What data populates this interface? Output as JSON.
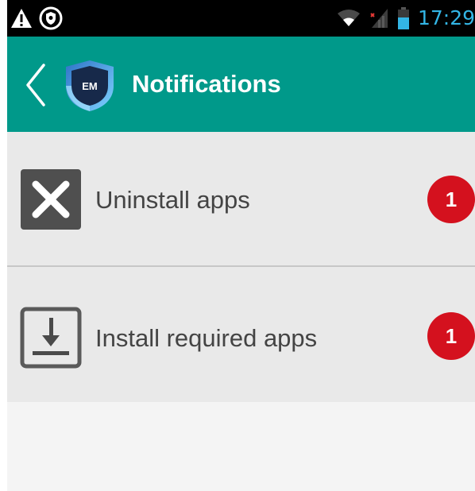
{
  "status_bar": {
    "time": "17:29",
    "left_icons": [
      "warning-icon",
      "shield-icon"
    ],
    "right_icons": [
      "wifi-icon",
      "signal-icon",
      "battery-icon"
    ]
  },
  "app_bar": {
    "title": "Notifications",
    "logo_text": "EM",
    "back_icon": "chevron-left-icon",
    "background": "#00998a"
  },
  "list": {
    "items": [
      {
        "label": "Uninstall apps",
        "badge": "1",
        "icon": "close-box-icon"
      },
      {
        "label": "Install required apps",
        "badge": "1",
        "icon": "download-box-icon"
      }
    ]
  },
  "colors": {
    "accent": "#00998a",
    "badge": "#d4111e",
    "time": "#33b5e5"
  }
}
